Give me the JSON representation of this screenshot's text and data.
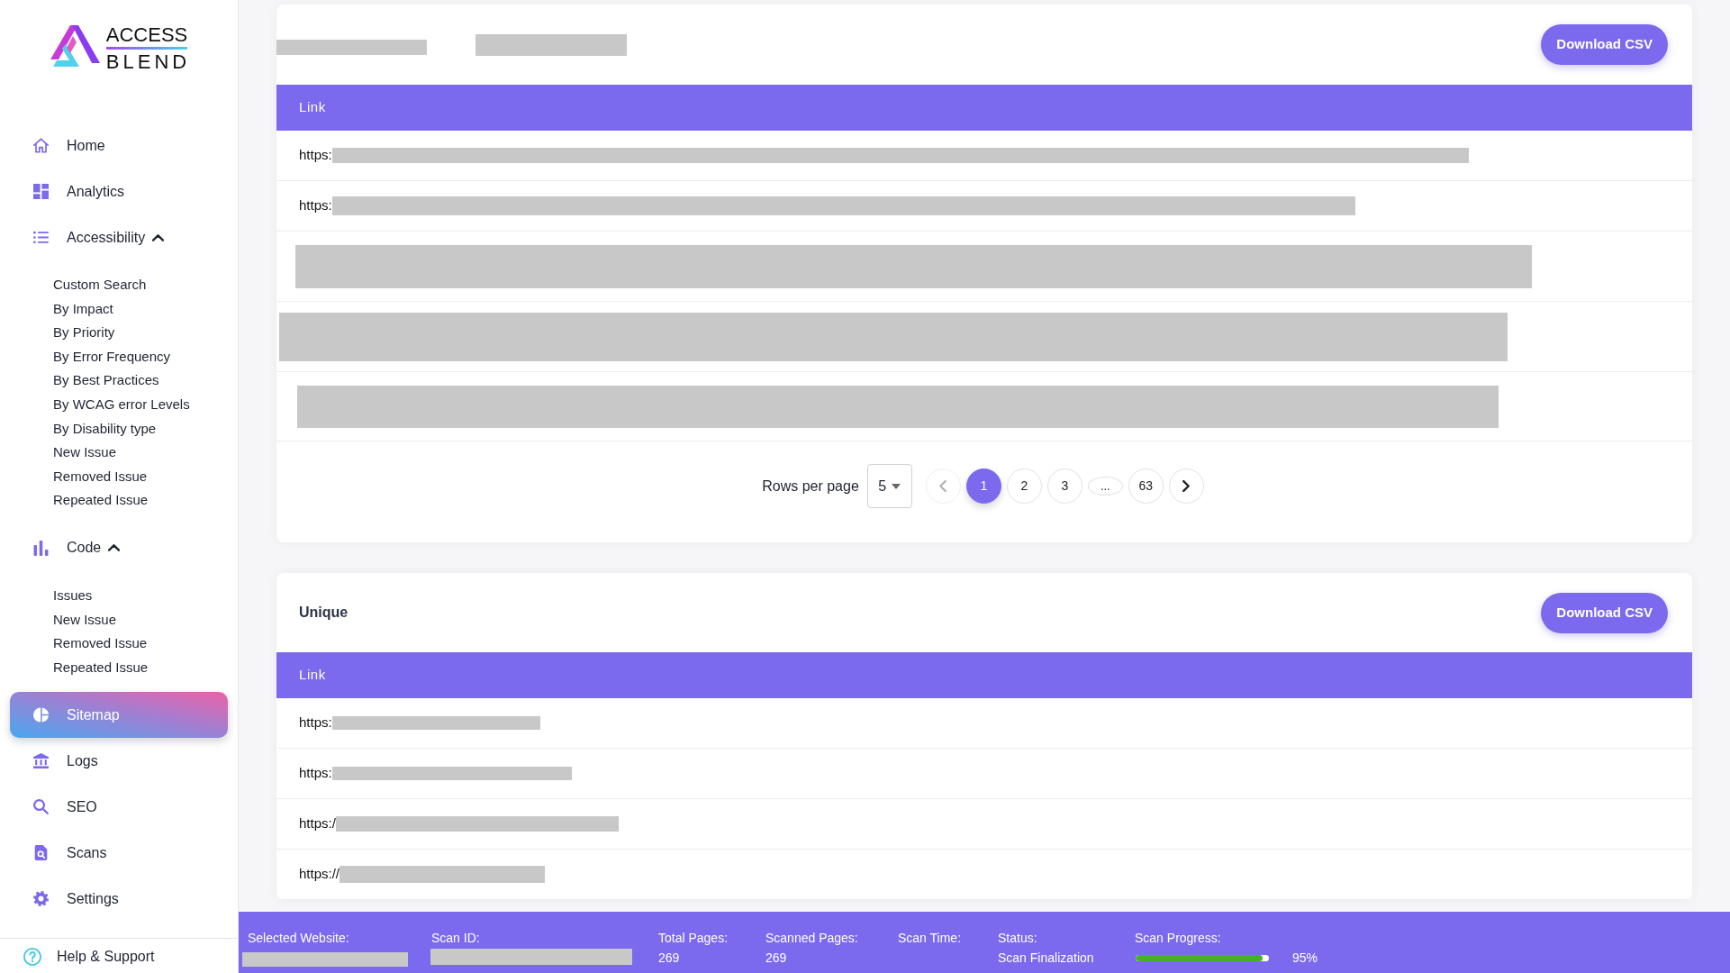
{
  "sidebar": {
    "logo": {
      "line_1": "ACCESS",
      "line_2": "BLEND"
    },
    "items": [
      {
        "label": "Home",
        "selected": false
      },
      {
        "label": "Analytics",
        "selected": false
      },
      {
        "label": "Accessibility",
        "selected": false,
        "expanded": true,
        "children": [
          {
            "label": "Custom Search",
            "selected": false
          },
          {
            "label": "By Impact",
            "selected": false
          },
          {
            "label": "By Priority",
            "selected": false
          },
          {
            "label": "By Error Frequency",
            "selected": false
          },
          {
            "label": "By Best Practices",
            "selected": false
          },
          {
            "label": "By WCAG error Levels",
            "selected": false
          },
          {
            "label": "By Disability type",
            "selected": false
          },
          {
            "label": "New Issue",
            "selected": false
          },
          {
            "label": "Removed Issue",
            "selected": false
          },
          {
            "label": "Repeated Issue",
            "selected": false
          }
        ]
      },
      {
        "label": "Code",
        "selected": false,
        "expanded": true,
        "children": [
          {
            "label": "Issues",
            "selected": false
          },
          {
            "label": "New Issue",
            "selected": false
          },
          {
            "label": "Removed Issue",
            "selected": false
          },
          {
            "label": "Repeated Issue",
            "selected": false
          }
        ]
      },
      {
        "label": "Sitemap",
        "selected": true
      },
      {
        "label": "Logs",
        "selected": false
      },
      {
        "label": "SEO",
        "selected": false
      },
      {
        "label": "Scans",
        "selected": false
      },
      {
        "label": "Settings",
        "selected": false
      }
    ],
    "footer": {
      "label": "Help & Support"
    }
  },
  "cards": [
    {
      "title": {
        "kind": "redacted"
      },
      "button": "Download CSV",
      "table": {
        "columns": [
          "Link"
        ],
        "rows": [
          {
            "kind": "partly_redacted",
            "text": "https:"
          },
          {
            "kind": "partly_redacted",
            "text": "https:"
          },
          {
            "kind": "redacted"
          },
          {
            "kind": "redacted"
          },
          {
            "kind": "redacted"
          }
        ]
      },
      "pagination": {
        "label": "Rows per page",
        "rows_per_page": "5",
        "prev": {
          "disabled": true
        },
        "pages": [
          {
            "kind": "page",
            "label": "1",
            "selected": true
          },
          {
            "kind": "page",
            "label": "2",
            "selected": false
          },
          {
            "kind": "page",
            "label": "3",
            "selected": false
          },
          {
            "kind": "ellipsis",
            "label": "...",
            "selected": false
          },
          {
            "kind": "page",
            "label": "63",
            "selected": false
          }
        ],
        "next": {
          "disabled": false
        }
      }
    },
    {
      "title": {
        "kind": "plain",
        "text": "Unique"
      },
      "button": "Download CSV",
      "table": {
        "columns": [
          "Link"
        ],
        "rows": [
          {
            "kind": "partly_redacted",
            "text": "https:"
          },
          {
            "kind": "partly_redacted",
            "text": "https:"
          },
          {
            "kind": "partly_redacted",
            "text": "https:/"
          },
          {
            "kind": "partly_redacted",
            "text": "https://"
          }
        ]
      }
    }
  ],
  "status_bar": {
    "fields": [
      {
        "label": "Selected Website:",
        "kind": "redacted"
      },
      {
        "label": "Scan ID:",
        "kind": "redacted"
      },
      {
        "label": "Total Pages:",
        "kind": "text",
        "value": "269"
      },
      {
        "label": "Scanned Pages:",
        "kind": "text",
        "value": "269"
      },
      {
        "label": "Scan Time:",
        "kind": "text"
      },
      {
        "label": "Status:",
        "kind": "text",
        "value": "Scan Finalization"
      },
      {
        "label": "Scan Progress:",
        "kind": "progress",
        "level": 0.95,
        "reading": "95%"
      }
    ]
  }
}
